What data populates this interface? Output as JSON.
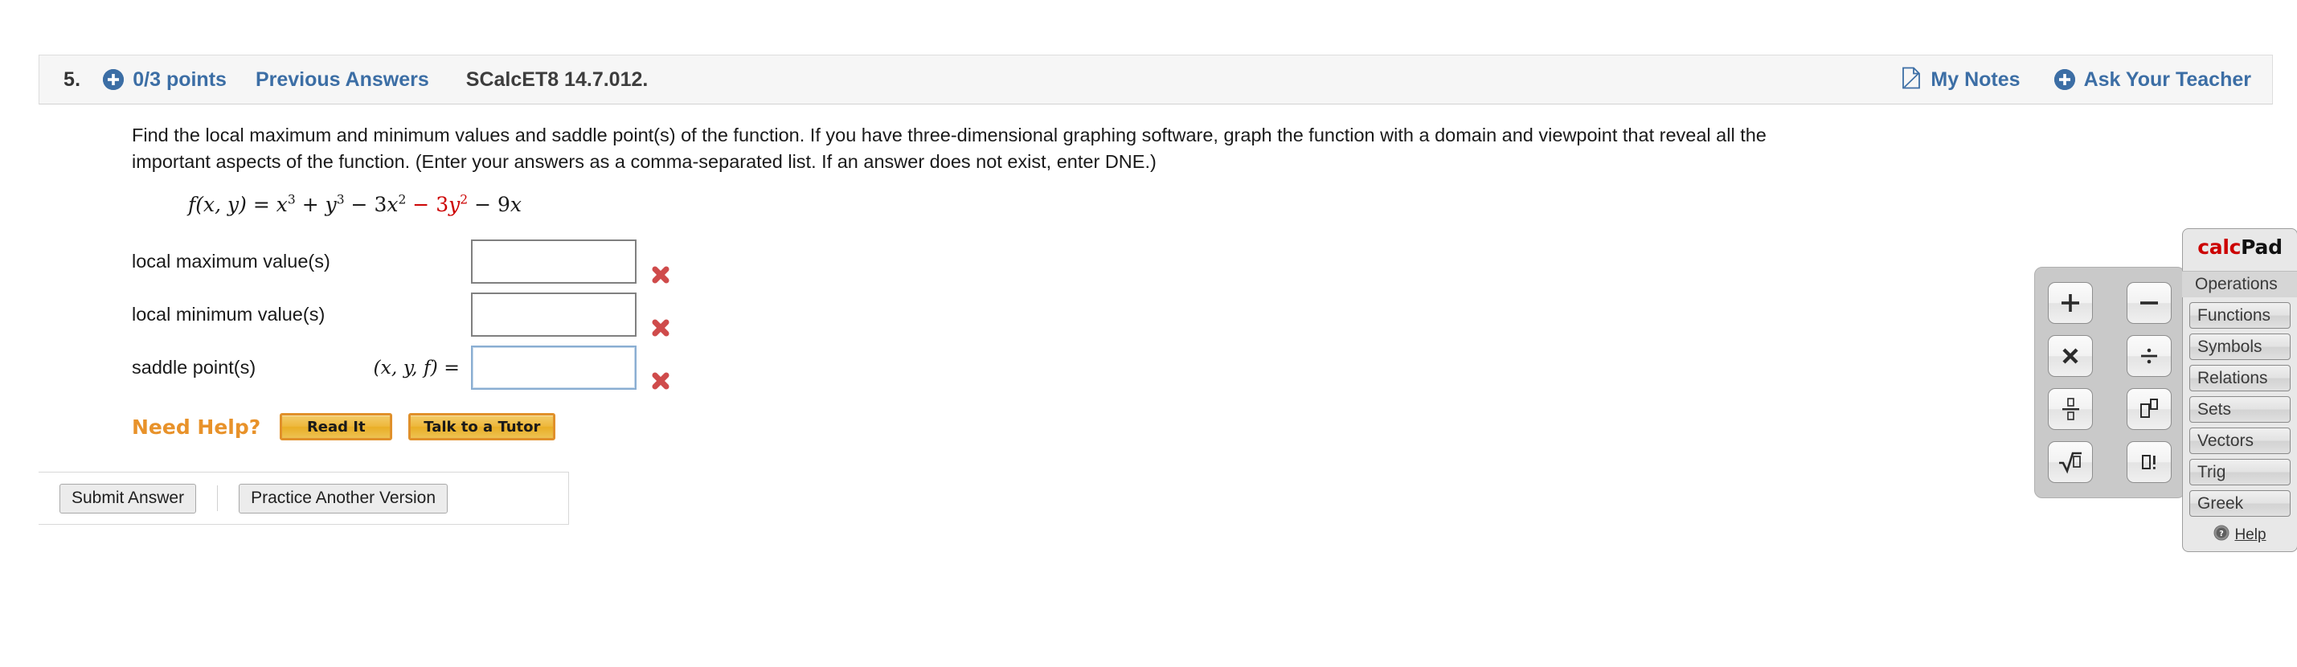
{
  "header": {
    "question_number": "5.",
    "points": "0/3 points",
    "previous_answers": "Previous Answers",
    "problem_id": "SCalcET8 14.7.012.",
    "my_notes": "My Notes",
    "ask_your_teacher": "Ask Your Teacher",
    "accent_blue": "#3c6ea5"
  },
  "question": {
    "line1": "Find the local maximum and minimum values and saddle point(s) of the function. If you have three-dimensional graphing software, graph the function with a domain and viewpoint that reveal all the",
    "line2": "important aspects of the function. (Enter your answers as a comma-separated list. If an answer does not exist, enter DNE.)",
    "function": {
      "lhs": "f(x, y)",
      "equals": "=",
      "terms": [
        {
          "text": "x",
          "sup": "3",
          "op": "",
          "color": "#1a1a1a"
        },
        {
          "text": "y",
          "sup": "3",
          "op": "+",
          "color": "#1a1a1a"
        },
        {
          "text": "3x",
          "sup": "2",
          "op": "−",
          "color": "#1a1a1a"
        },
        {
          "text": "3y",
          "sup": "2",
          "op": "−",
          "color": "#cc0000"
        },
        {
          "text": "9x",
          "sup": "",
          "op": "−",
          "color": "#1a1a1a"
        }
      ],
      "plain": "f(x, y) = x^3 + y^3 - 3x^2 - 3y^2 - 9x",
      "highlight_color": "#cc0000"
    }
  },
  "answers": {
    "rows": [
      {
        "label": "local maximum value(s)",
        "tuple_prefix": "",
        "value": "",
        "placeholder": "",
        "focused": false,
        "status": "incorrect",
        "status_icon": "red-x-icon"
      },
      {
        "label": "local minimum value(s)",
        "tuple_prefix": "",
        "value": "",
        "placeholder": "",
        "focused": false,
        "status": "incorrect",
        "status_icon": "red-x-icon"
      },
      {
        "label": "saddle point(s)",
        "tuple_prefix": "(x, y, f) =",
        "value": "",
        "placeholder": "",
        "focused": true,
        "status": "incorrect",
        "status_icon": "red-x-icon"
      }
    ],
    "incorrect_color": "#cf4b4b"
  },
  "need_help": {
    "label": "Need Help?",
    "label_color": "#e8922a",
    "buttons": [
      "Read It",
      "Talk to a Tutor"
    ]
  },
  "footer": {
    "submit_label": "Submit Answer",
    "practice_label": "Practice Another Version"
  },
  "calcpad": {
    "title_calc": "calc",
    "title_pad": "Pad",
    "title_calc_color": "#cc0000",
    "keys": [
      {
        "name": "plus-key",
        "glyph": "+"
      },
      {
        "name": "minus-key",
        "glyph": "−"
      },
      {
        "name": "multiply-key",
        "glyph": "x"
      },
      {
        "name": "divide-key",
        "glyph": "÷"
      },
      {
        "name": "fraction-key",
        "glyph": "□/□"
      },
      {
        "name": "exponent-key",
        "glyph": "□^□"
      },
      {
        "name": "square-root-key",
        "glyph": "√□"
      },
      {
        "name": "factorial-key",
        "glyph": "□!"
      }
    ],
    "categories": [
      {
        "label": "Operations",
        "selected": true
      },
      {
        "label": "Functions",
        "selected": false
      },
      {
        "label": "Symbols",
        "selected": false
      },
      {
        "label": "Relations",
        "selected": false
      },
      {
        "label": "Sets",
        "selected": false
      },
      {
        "label": "Vectors",
        "selected": false
      },
      {
        "label": "Trig",
        "selected": false
      },
      {
        "label": "Greek",
        "selected": false
      }
    ],
    "help_label": "Help"
  }
}
